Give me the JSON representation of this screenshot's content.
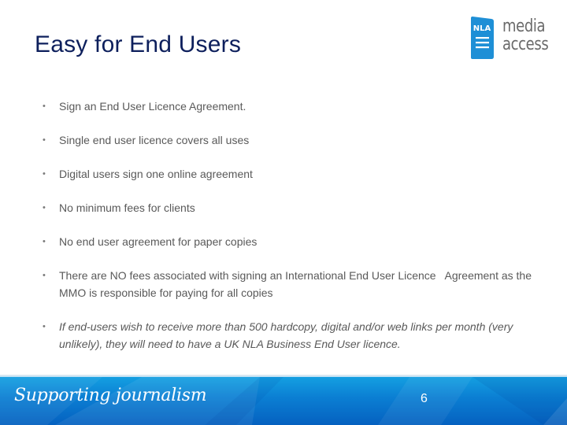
{
  "slide": {
    "title": "Easy for End Users",
    "logo": {
      "badge_text": "NLA",
      "line1": "media",
      "line2": "access",
      "brand_color": "#1e8fd6"
    },
    "bullets": [
      {
        "text": "Sign an End User Licence Agreement.",
        "italic": false
      },
      {
        "text": "Single end user licence covers all uses",
        "italic": false
      },
      {
        "text": "Digital users sign one online agreement",
        "italic": false
      },
      {
        "text": "No minimum fees for clients",
        "italic": false
      },
      {
        "text": "No end user agreement for paper copies",
        "italic": false
      },
      {
        "text": "There are NO fees associated with signing an International End User Licence   Agreement as the MMO is responsible for paying for all copies",
        "italic": false
      },
      {
        "text": "If end-users wish to receive more than 500 hardcopy, digital and/or web links per month (very unlikely), they will need to have a UK NLA Business End User licence.",
        "italic": true
      }
    ],
    "bullet_glyph": "•",
    "footer": {
      "tagline": "Supporting journalism",
      "page_number": "6"
    },
    "colors": {
      "title": "#0d1f5c",
      "body_text": "#595959",
      "footer_blue": "#0b7fd3"
    }
  }
}
